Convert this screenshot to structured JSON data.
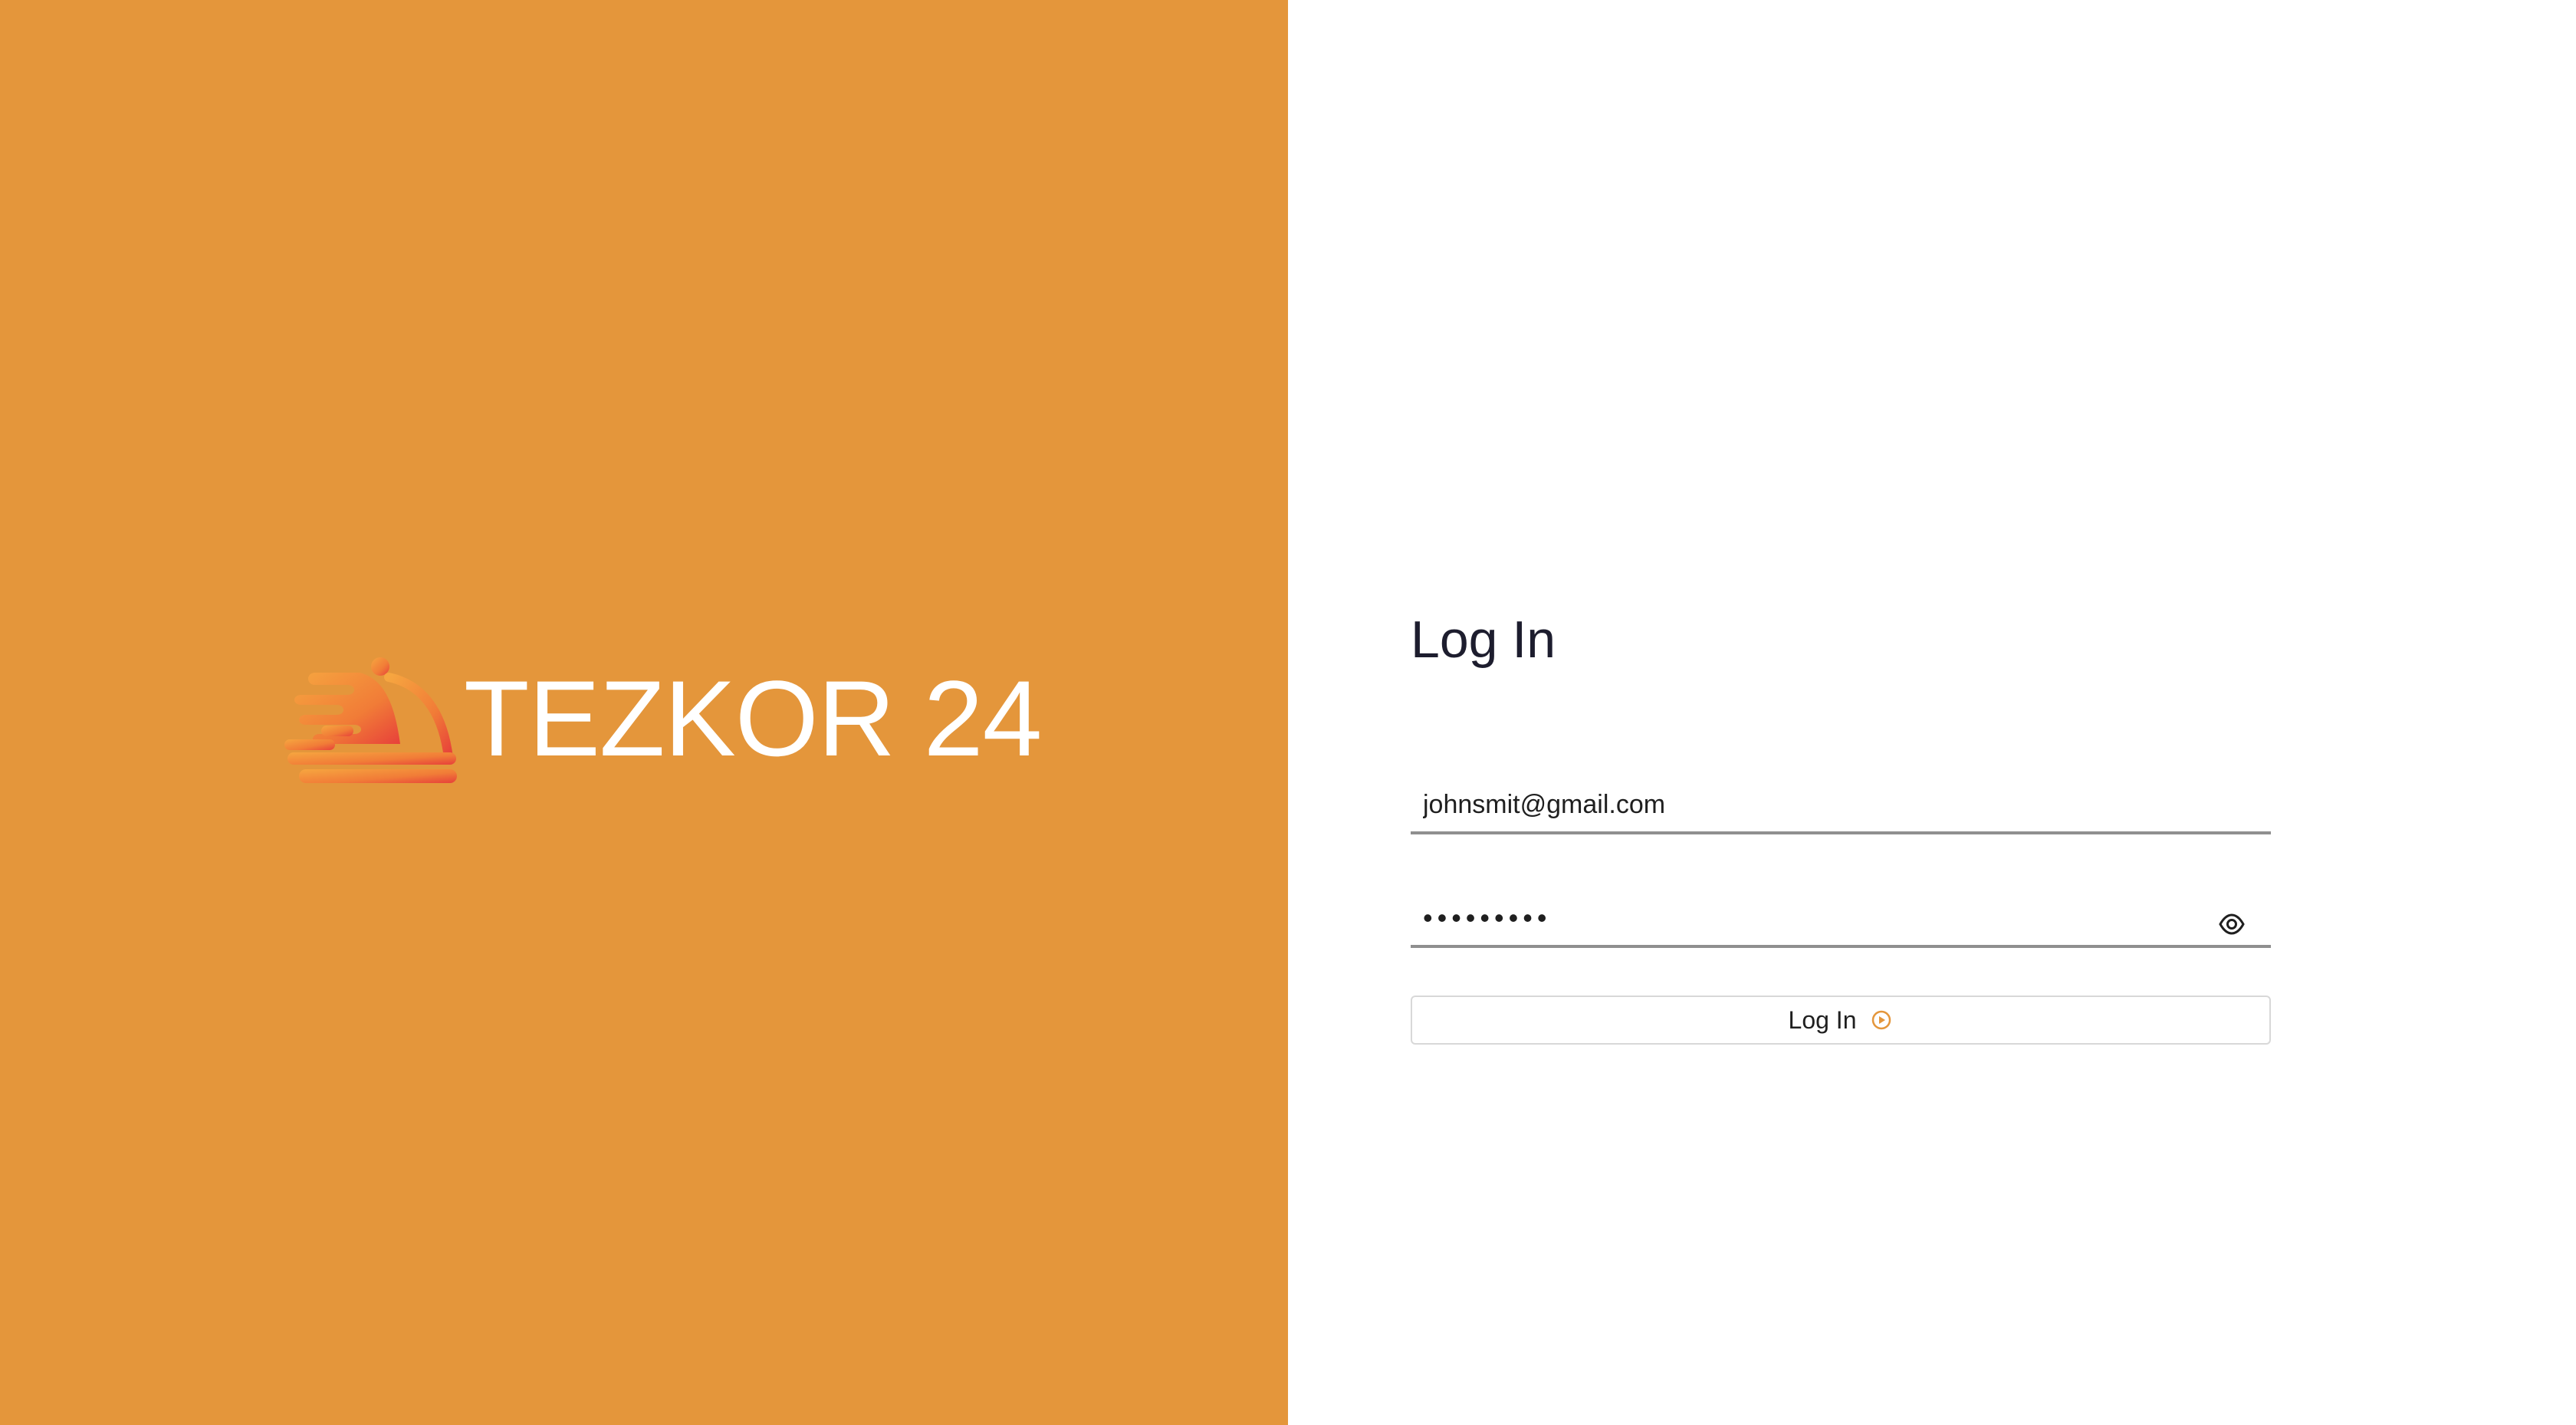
{
  "brand": {
    "name": "TEZKOR 24",
    "logo_icon": "food-delivery-cloche-icon",
    "background_color": "#e4963b",
    "logo_gradient": [
      "#f28a36",
      "#e7403a"
    ]
  },
  "login": {
    "title": "Log In",
    "email_value": "johnsmit@gmail.com",
    "password_value": "•••••••••",
    "password_toggle_icon": "eye-icon",
    "submit_label": "Log In",
    "submit_icon": "play-circle-icon",
    "accent_color": "#e4963b"
  }
}
